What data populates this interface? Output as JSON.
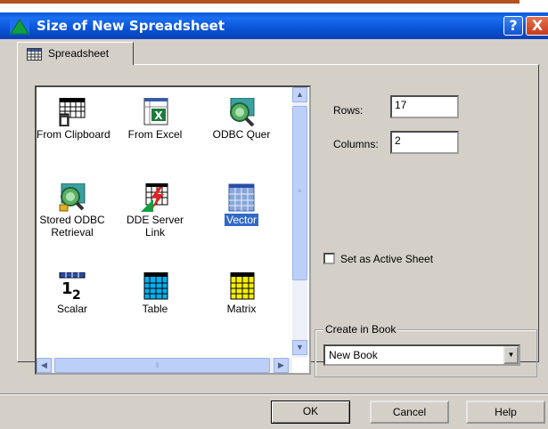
{
  "window": {
    "title": "Size of New Spreadsheet",
    "help_glyph": "?",
    "close_glyph": "X"
  },
  "tab": {
    "label": "Spreadsheet",
    "icon": "spreadsheet-grid-icon"
  },
  "listview": {
    "items": [
      {
        "label": "From Clipboard",
        "icon": "clipboard-grid-icon"
      },
      {
        "label": "From Excel",
        "icon": "excel-icon"
      },
      {
        "label": "ODBC Quer",
        "icon": "odbc-globe-icon"
      },
      {
        "label_line1": "Stored ODBC",
        "label_line2": "Retrieval",
        "icon": "stored-odbc-icon"
      },
      {
        "label_line1": "DDE Server",
        "label_line2": "Link",
        "icon": "dde-server-icon"
      },
      {
        "label": "Vector",
        "icon": "vector-grid-icon",
        "selected": true
      },
      {
        "label": "Scalar",
        "icon": "scalar-icon"
      },
      {
        "label": "Table",
        "icon": "table-grid-icon"
      },
      {
        "label": "Matrix",
        "icon": "matrix-grid-icon"
      }
    ],
    "scroll_up": "▲",
    "scroll_down": "▼",
    "scroll_left": "◀",
    "scroll_right": "▶"
  },
  "form": {
    "rows_label": "Rows:",
    "rows_value": "17",
    "columns_label": "Columns:",
    "columns_value": "2",
    "active_sheet_label": "Set as Active Sheet",
    "create_in_book_label": "Create in Book",
    "book_value": "New Book"
  },
  "buttons": {
    "ok": "OK",
    "cancel": "Cancel",
    "help": "Help"
  },
  "colors": {
    "titlebar": "#0a58d8",
    "selection": "#316ac5",
    "dialog_bg": "#d4d0c8"
  }
}
